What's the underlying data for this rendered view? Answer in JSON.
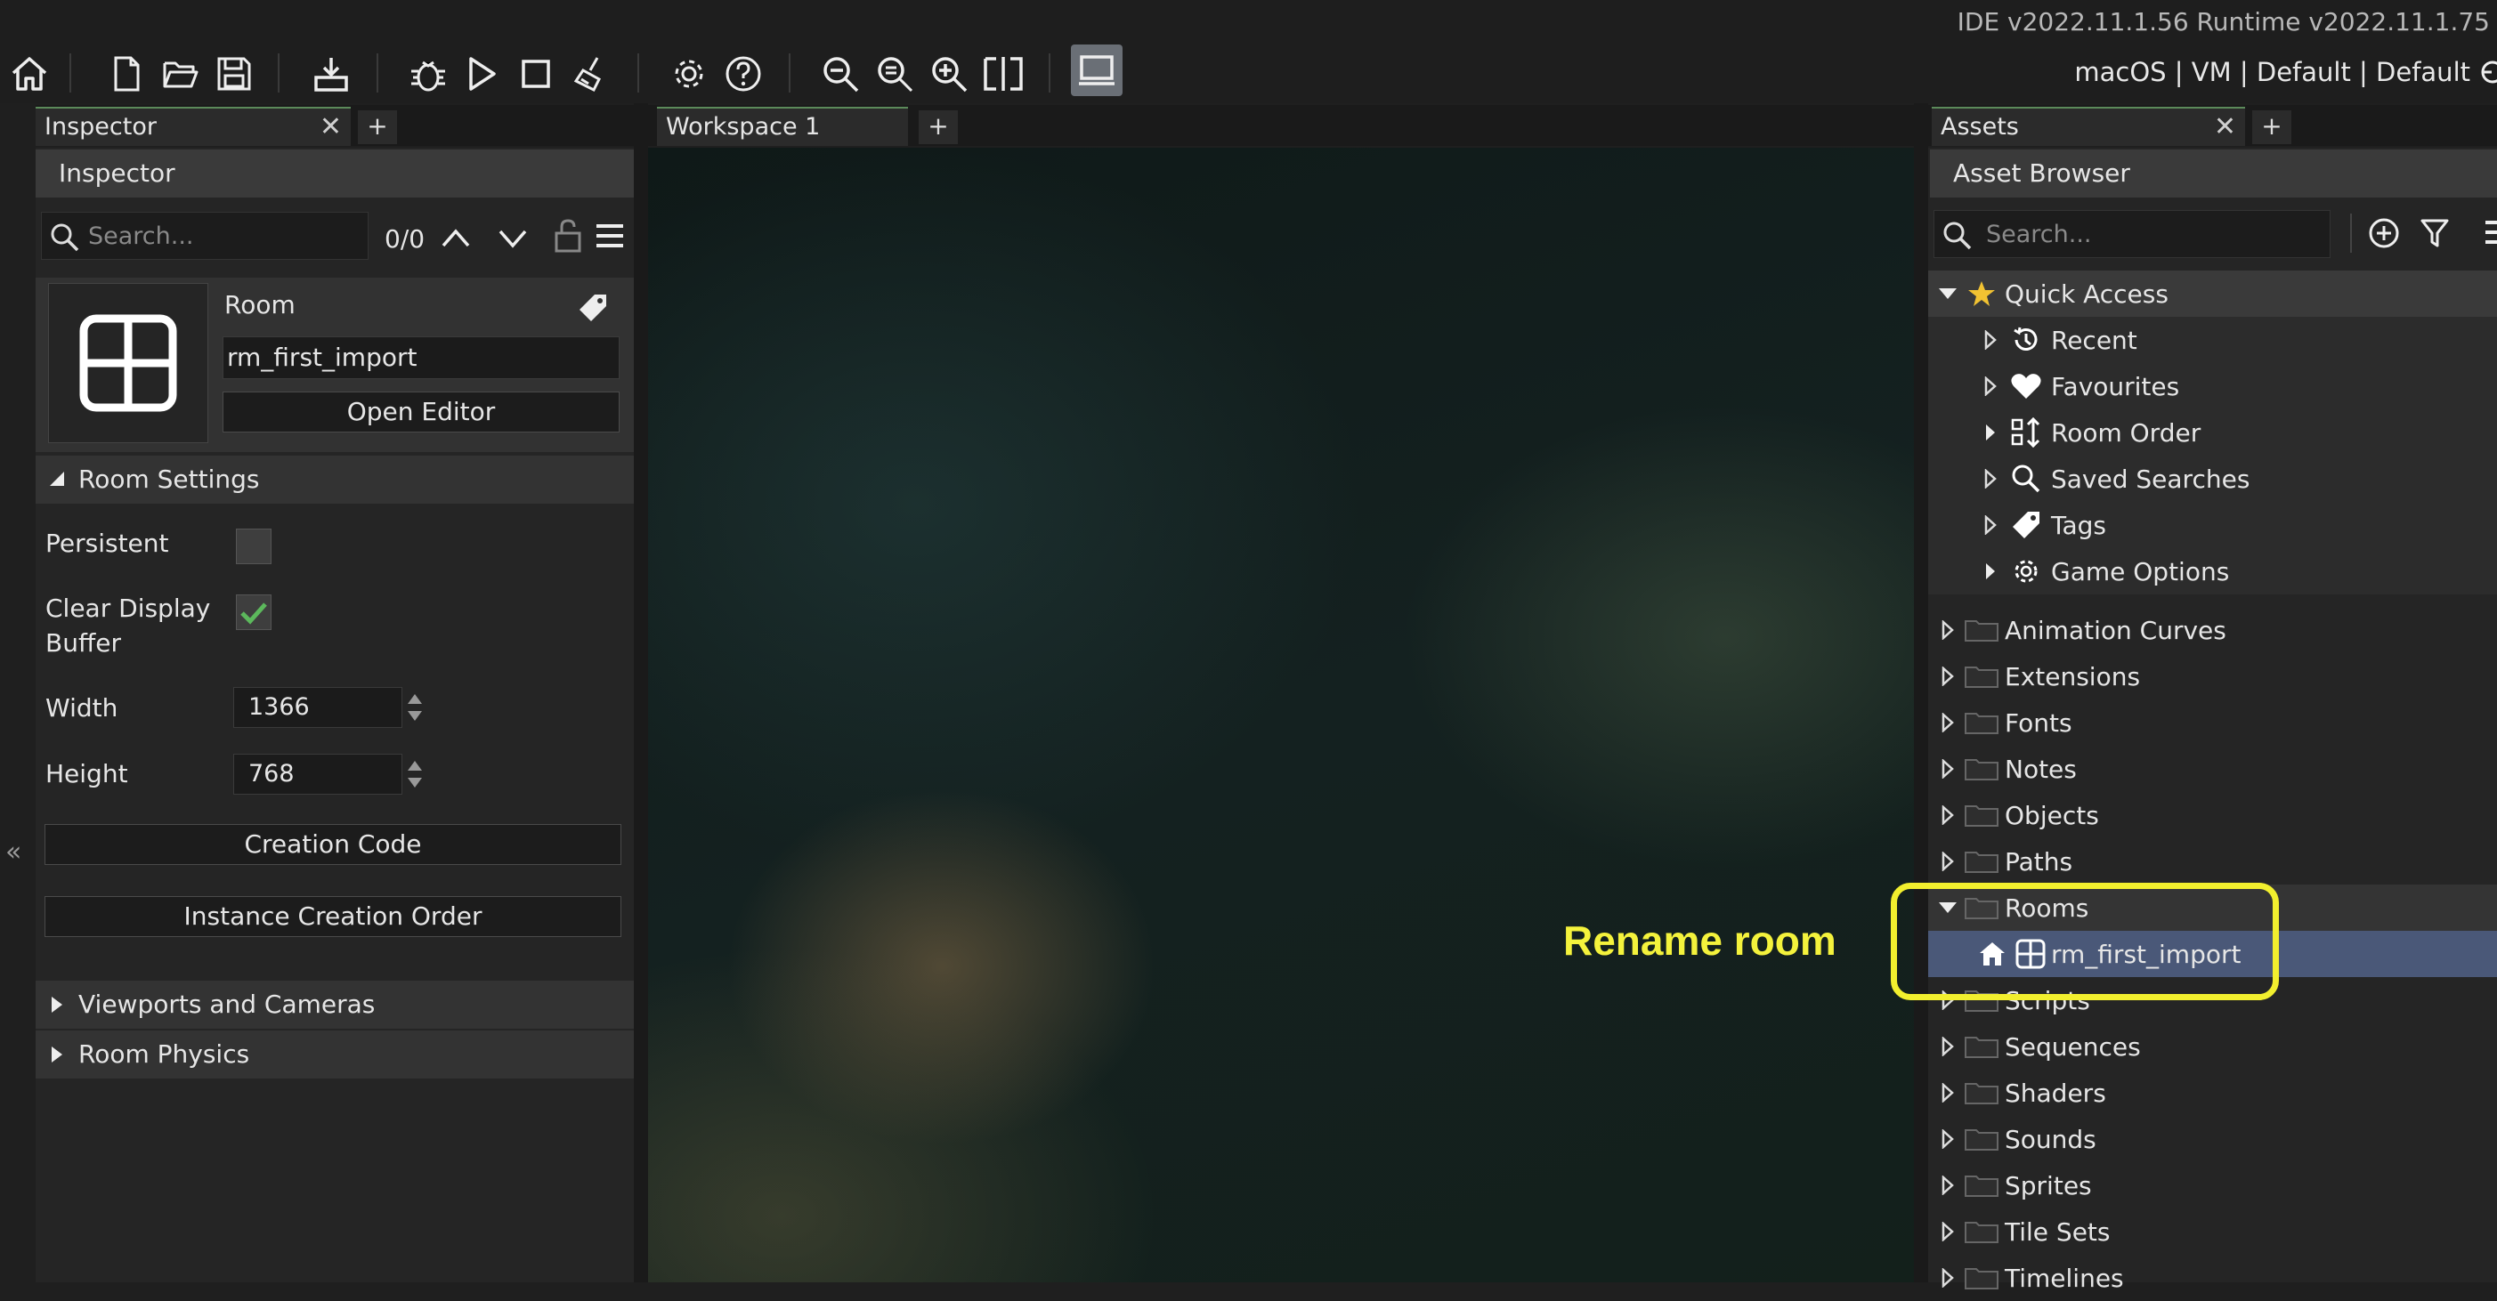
{
  "app": {
    "version_text": "IDE v2022.11.1.56  Runtime v2022.11.1.75",
    "target_label": "macOS | VM | Default | Default"
  },
  "toolbar": {
    "icons": [
      "home-icon",
      "new-file-icon",
      "open-folder-icon",
      "save-icon",
      "create-executable-icon",
      "debug-icon",
      "run-icon",
      "stop-icon",
      "clean-icon",
      "preferences-icon",
      "help-icon",
      "zoom-out-icon",
      "zoom-reset-icon",
      "zoom-in-icon",
      "fit-icon",
      "target-device-icon"
    ]
  },
  "inspector": {
    "tab_label": "Inspector",
    "header": "Inspector",
    "search_placeholder": "Search...",
    "match_count": "0/0",
    "resource_type": "Room",
    "resource_name": "rm_first_import",
    "open_editor": "Open Editor",
    "room_settings": "Room Settings",
    "persistent_label": "Persistent",
    "persistent_checked": false,
    "clear_display_label_1": "Clear Display",
    "clear_display_label_2": "Buffer",
    "clear_display_checked": true,
    "width_label": "Width",
    "width_value": "1366",
    "height_label": "Height",
    "height_value": "768",
    "creation_code": "Creation Code",
    "instance_creation_order": "Instance Creation Order",
    "viewports": "Viewports and Cameras",
    "physics": "Room Physics"
  },
  "workspace": {
    "tab_label": "Workspace 1",
    "annotation": "Rename room"
  },
  "assets": {
    "tab_label": "Assets",
    "header": "Asset Browser",
    "search_placeholder": "Search...",
    "quick_access": "Quick Access",
    "quick_items": [
      "Recent",
      "Favourites",
      "Room Order",
      "Saved Searches",
      "Tags",
      "Game Options"
    ],
    "folders_top": [
      "Animation Curves",
      "Extensions",
      "Fonts",
      "Notes",
      "Objects",
      "Paths"
    ],
    "rooms_folder": "Rooms",
    "room_item": "rm_first_import",
    "folders_bottom": [
      "Scripts",
      "Sequences",
      "Shaders",
      "Sounds",
      "Sprites",
      "Tile Sets",
      "Timelines"
    ]
  },
  "colors": {
    "accent_highlight": "#f2ef2e",
    "selection": "#4a5878",
    "check_green": "#5cb85c"
  }
}
